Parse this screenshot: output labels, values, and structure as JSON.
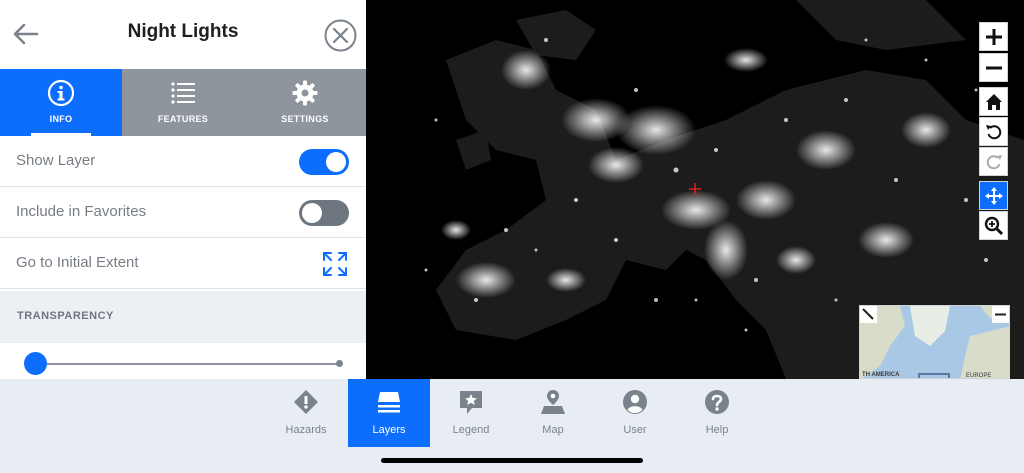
{
  "panel": {
    "title": "Night Lights",
    "tabs": [
      {
        "label": "INFO",
        "icon": "info-icon",
        "active": true
      },
      {
        "label": "FEATURES",
        "icon": "list-icon",
        "active": false
      },
      {
        "label": "SETTINGS",
        "icon": "gear-icon",
        "active": false
      }
    ],
    "rows": {
      "show_layer": {
        "label": "Show Layer",
        "on": true
      },
      "include_favorites": {
        "label": "Include in Favorites",
        "on": false
      },
      "initial_extent": {
        "label": "Go to Initial Extent"
      }
    },
    "transparency": {
      "label": "TRANSPARENCY",
      "value": 0
    }
  },
  "map": {
    "controls": [
      "zoom-in-icon",
      "zoom-out-icon",
      "home-icon",
      "undo-icon",
      "redo-icon",
      "pan-icon",
      "zoom-box-icon"
    ],
    "overview": {
      "label_left": "TH AMERICA",
      "label_right": "EUROPE"
    }
  },
  "nav": {
    "items": [
      {
        "label": "Hazards",
        "icon": "hazard-icon",
        "active": false
      },
      {
        "label": "Layers",
        "icon": "layers-icon",
        "active": true
      },
      {
        "label": "Legend",
        "icon": "legend-icon",
        "active": false
      },
      {
        "label": "Map",
        "icon": "map-icon",
        "active": false
      },
      {
        "label": "User",
        "icon": "user-icon",
        "active": false
      },
      {
        "label": "Help",
        "icon": "help-icon",
        "active": false
      }
    ]
  },
  "colors": {
    "accent": "#0d6efd",
    "tab_bg": "#8e959d",
    "map_bg": "#000000"
  }
}
